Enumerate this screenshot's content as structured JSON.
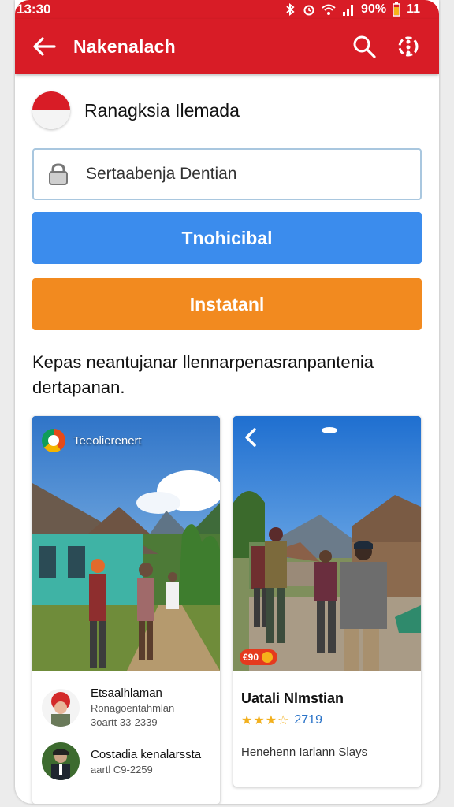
{
  "status_bar": {
    "time": "13:30",
    "battery": "90%",
    "extra": "11"
  },
  "app_bar": {
    "title": "Nakenalach"
  },
  "profile": {
    "name": "Ranagksia Ilemada"
  },
  "search": {
    "placeholder": "Sertaabenja Dentian"
  },
  "buttons": {
    "primary": "Tnohicibal",
    "secondary": "Instatanl"
  },
  "description": "Kepas neantujanar llennarpenasranpantenia dertapanan.",
  "cards": {
    "left": {
      "badge_text": "Teeolierenert",
      "items": [
        {
          "title": "Etsaalhlaman",
          "subtitle": "Ronagoentahmlan",
          "meta": "3oartt 33-2339"
        },
        {
          "title": "Costadia kenalarssta",
          "subtitle": "",
          "meta": "aartl C9-2259"
        }
      ]
    },
    "right": {
      "price_badge": "€90",
      "title": "Uatali Nlmstian",
      "rating_value": "2719",
      "footer": "Henehenn Iarlann Slays"
    }
  },
  "colors": {
    "brand_red": "#d81c26",
    "primary_blue": "#3b8ced",
    "accent_orange": "#f28a1f"
  }
}
